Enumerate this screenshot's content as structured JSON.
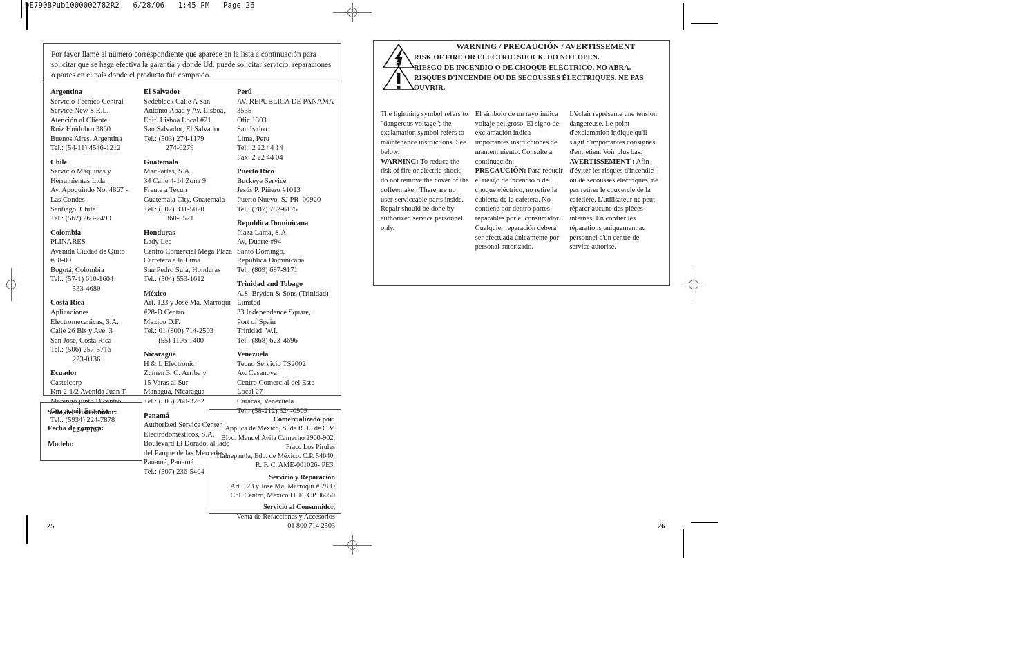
{
  "slug": "DE790BPub1000002782R2   6/28/06   1:45 PM   Page 26",
  "left_page": {
    "intro": "Por favor llame al número correspondiente que aparece en la lista a continuación para solicitar que se haga efectiva la garantía y donde Ud. puede solicitar servicio, reparaciones o partes en el país donde el producto fué comprado.",
    "columns": [
      {
        "entries": [
          {
            "country": "Argentina",
            "lines": [
              "Servicio Técnico Central",
              "Service New S.R.L.",
              "Atención al Cliente",
              "Ruiz Huidobro 3860",
              "Buenos Aires, Argentina",
              "Tel.: (54-11) 4546-1212"
            ]
          },
          {
            "country": "Chile",
            "lines": [
              "Servicio Máquinas y",
              "Herramientas Ltda.",
              "Av. Apoquindo No. 4867 -",
              "Las Condes",
              "Santiago, Chile",
              "Tel.: (562) 263-2490"
            ]
          },
          {
            "country": "Colombia",
            "lines": [
              "PLINARES",
              "Avenida Ciudad de Quito",
              "#88-09",
              "Bogotá, Colombia",
              "Tel.: (57-1) 610-1604",
              "            533-4680"
            ]
          },
          {
            "country": "Costa Rica",
            "lines": [
              "Aplicaciones",
              "Electromecanicas, S.A.",
              "Calle 26 Bis y Ave. 3",
              "San Jose, Costa Rica",
              "Tel.: (506) 257-5716",
              "            223-0136"
            ]
          },
          {
            "country": "Ecuador",
            "lines": [
              "Castelcorp",
              "Km 2-1/2 Avenida Juan T.",
              "Marengo junto Dicentro",
              "Guayaquil, Ecuador",
              "Tel.: (5934) 224-7878",
              "            224-1767"
            ]
          }
        ]
      },
      {
        "entries": [
          {
            "country": "El Salvador",
            "lines": [
              "Sedeblack Calle A San",
              "Antonio Abad y Av. Lisboa,",
              "Edif. Lisboa Local #21",
              "San Salvador, El Salvador",
              "Tel.: (503) 274-1179",
              "            274-0279"
            ]
          },
          {
            "country": "Guatemala",
            "lines": [
              "MacPartes, S.A.",
              "34 Calle 4-14 Zona 9",
              "Frente a Tecun",
              "Guatemala City, Guatemala",
              "Tel.: (502) 331-5020",
              "            360-0521"
            ]
          },
          {
            "country": "Honduras",
            "lines": [
              "Lady Lee",
              "Centro Comercial Mega Plaza",
              "Carretera a la Lima",
              "San Pedro Sula, Honduras",
              "Tel.: (504) 553-1612"
            ]
          },
          {
            "country": "México",
            "lines": [
              "Art. 123 y José Ma. Marroquí",
              "#28-D Centro.",
              "Mexico D.F.",
              "Tel.: 01 (800) 714-2503",
              "        (55) 1106-1400"
            ]
          },
          {
            "country": "Nicaragua",
            "lines": [
              "H & L Electronic",
              "Zumen 3, C. Arriba y",
              "15 Varas al Sur",
              "Managua, Nicaragua",
              "Tel.: (505) 260-3262"
            ]
          },
          {
            "country": "Panamá",
            "lines": [
              "Authorized Service Center",
              "Electrodomésticos, S.A.",
              "Boulevard El Dorado, al lado",
              "del Parque de las Mercedes",
              "Panamá, Panamá",
              "Tel.: (507) 236-5404"
            ]
          }
        ]
      },
      {
        "entries": [
          {
            "country": "Perú",
            "lines": [
              "AV. REPUBLICA DE PANAMA",
              "3535",
              "Ofic 1303",
              "San Isidro",
              "Lima, Peru",
              "Tel.: 2 22 44 14",
              "Fax: 2 22 44 04"
            ]
          },
          {
            "country": "Puerto Rico",
            "lines": [
              "Buckeye Service",
              "Jesús P. Piñero #1013",
              "Puerto Nuevo, SJ PR  00920",
              "Tel.: (787) 782-6175"
            ]
          },
          {
            "country": "Republica Dominicana",
            "lines": [
              "Plaza Lama, S.A.",
              "Av, Duarte #94",
              "Santo Domingo,",
              "República Dominicana",
              "Tel.: (809) 687-9171"
            ]
          },
          {
            "country": "Trinidad and Tobago",
            "lines": [
              "A.S. Bryden & Sons (Trinidad)",
              "Limited",
              "33 Independence Square,",
              "Port of Spain",
              "Trinidad, W.I.",
              "Tel.: (868) 623-4696"
            ]
          },
          {
            "country": "Venezuela",
            "lines": [
              "Tecno Servicio TS2002",
              "Av. Casanova",
              "Centro Comercial del Este",
              "Local 27",
              "Caracas, Venezuela",
              "Tel.: (58-212) 324-0969"
            ]
          }
        ]
      }
    ],
    "stamp_box": {
      "line1": "Sello del Distribuidor:",
      "line2": "Fecha de compra:",
      "line3": "Modelo:"
    },
    "comercializado": {
      "title": "Comercializado por:",
      "lines": [
        "Applica de México, S. de R. L. de C.V.",
        "Blvd. Manuel Avila Camacho 2900-902,",
        "Fracc Los Pirules",
        "Tlalnepantla, Edo. de México. C.P. 54040.",
        "R. F. C. AME-001026- PE3."
      ],
      "servicio_title": "Servicio y Reparación",
      "servicio_lines": [
        "Art. 123 y José Ma. Marroquí # 28 D",
        "Col. Centro, Mexico D. F., CP 06050"
      ],
      "consumidor_title": "Servicio al Consumidor,",
      "consumidor_lines": [
        "Venta de Refacciones y Accesorios",
        "01 800  714 2503"
      ]
    },
    "page_number": "25"
  },
  "right_page": {
    "warning": {
      "title": "WARNING / PRECAUCIÓN / AVERTISSEMENT",
      "line_en": "RISK OF FIRE OR ELECTRIC SHOCK. DO NOT OPEN.",
      "line_es": "RIESGO DE INCENDIO O DE CHOQUE ELÉCTRICO. NO ABRA.",
      "line_fr": "RISQUES D'INCENDIE OU DE SECOUSSES ÉLECTRIQUES. NE PAS OUVRIR."
    },
    "columns": {
      "english": {
        "intro": "The lightning symbol refers to \"dangerous voltage\"; the exclamation symbol refers to maintenance instructions. See below.",
        "label": "WARNING:",
        "body": " To reduce the risk of fire or electric shock, do not remove the cover of the coffeemaker. There are no user-serviceable parts inside. Repair should be done by authorized service personnel only."
      },
      "spanish": {
        "intro": "El símbolo de un rayo indica voltaje peligroso. El signo de exclamación indica  importantes instrucciones de mantenimiento. Consulte a continuación:",
        "label": "PRECAUCIÓN:",
        "body": " Para reducir el riesgo de incendio o de choque eléctrico, no retire la cubierta de la cafetera. No contiene por dentro partes reparables por el consumidor. Cualquier reparación deberá ser efectuada únicamente por personal autorizado."
      },
      "french": {
        "intro": "L'éclair représente une tension dangereuse. Le point d'exclamation indique qu'il s'agit d'importantes consignes d'entretien. Voir plus bas.",
        "label": "AVERTISSEMENT :",
        "body": " Afin d'éviter les risques d'incendie ou de secousses électriques, ne pas retirer le couvercle de la cafetière. L'utilisateur ne peut réparer aucune des pièces internes. En confier les réparations uniquement au personnel d'un centre de service autorisé."
      }
    },
    "page_number": "26"
  },
  "icons": {
    "lightning_triangle": "lightning-bolt-warning-triangle",
    "exclamation_triangle": "exclamation-warning-triangle",
    "registration_mark": "registration-crosshair-mark"
  }
}
